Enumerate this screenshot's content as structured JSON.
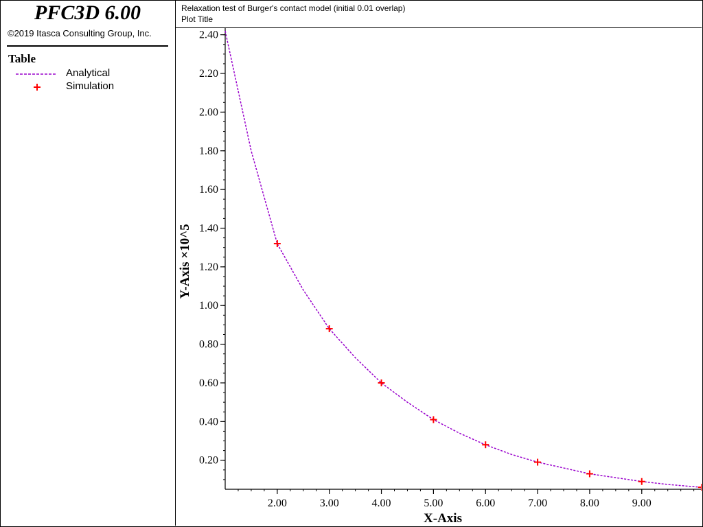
{
  "app": {
    "title": "PFC3D 6.00",
    "copyright": "©2019 Itasca Consulting Group, Inc."
  },
  "legend": {
    "title": "Table",
    "items": [
      {
        "label": "Analytical",
        "style": "dashed-line",
        "color": "#9900cc"
      },
      {
        "label": "Simulation",
        "style": "plus-marker",
        "color": "#ff0000"
      }
    ]
  },
  "header": {
    "line1": "Relaxation test of Burger's contact model (initial 0.01 overlap)",
    "line2": "Plot Title"
  },
  "chart_data": {
    "type": "line",
    "xlabel": "X-Axis",
    "ylabel": "Y-Axis ×10^5",
    "xlim": [
      1,
      10.15
    ],
    "ylim": [
      0.05,
      2.42
    ],
    "x_ticks": [
      2,
      3,
      4,
      5,
      6,
      7,
      8,
      9
    ],
    "x_tick_labels": [
      "2.00",
      "3.00",
      "4.00",
      "5.00",
      "6.00",
      "7.00",
      "8.00",
      "9.00"
    ],
    "y_ticks": [
      0.2,
      0.4,
      0.6,
      0.8,
      1.0,
      1.2,
      1.4,
      1.6,
      1.8,
      2.0,
      2.2,
      2.4
    ],
    "y_tick_labels": [
      "0.20",
      "0.40",
      "0.60",
      "0.80",
      "1.00",
      "1.20",
      "1.40",
      "1.60",
      "1.80",
      "2.00",
      "2.20",
      "2.40"
    ],
    "grid": false,
    "series": [
      {
        "name": "Analytical",
        "style": "dashed-line",
        "color": "#9900cc",
        "x": [
          1.0,
          1.5,
          2.0,
          2.5,
          3.0,
          3.5,
          4.0,
          4.5,
          5.0,
          5.5,
          6.0,
          6.5,
          7.0,
          7.5,
          8.0,
          8.5,
          9.0,
          9.5,
          10.15
        ],
        "y": [
          2.42,
          1.8,
          1.32,
          1.08,
          0.88,
          0.73,
          0.6,
          0.5,
          0.41,
          0.34,
          0.28,
          0.23,
          0.19,
          0.16,
          0.13,
          0.11,
          0.09,
          0.075,
          0.06
        ]
      },
      {
        "name": "Simulation",
        "style": "plus-marker",
        "color": "#ff0000",
        "x": [
          2,
          3,
          4,
          5,
          6,
          7,
          8,
          9,
          10.15
        ],
        "y": [
          1.32,
          0.88,
          0.6,
          0.41,
          0.28,
          0.19,
          0.13,
          0.09,
          0.06
        ]
      }
    ]
  }
}
